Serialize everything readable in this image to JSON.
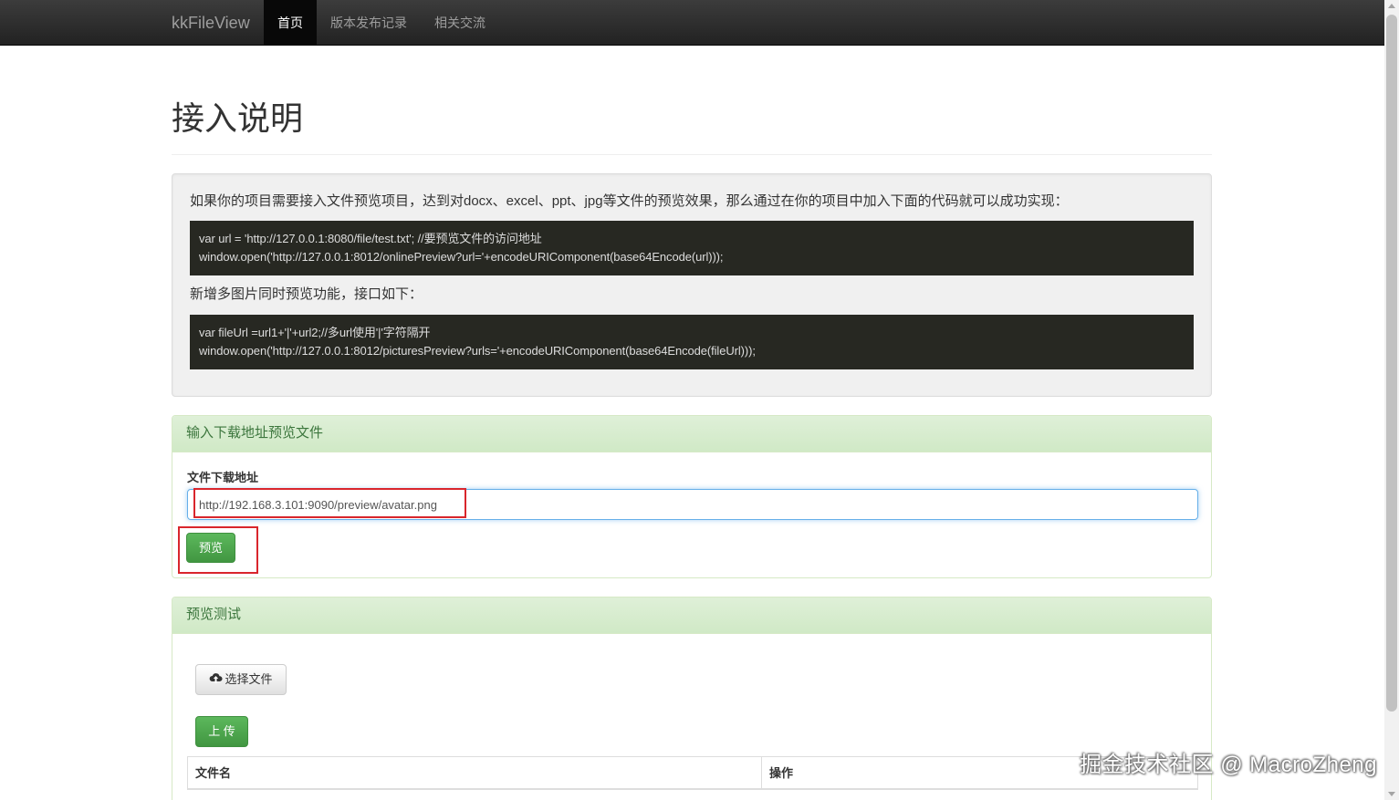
{
  "navbar": {
    "brand": "kkFileView",
    "items": [
      {
        "label": "首页",
        "active": true
      },
      {
        "label": "版本发布记录",
        "active": false
      },
      {
        "label": "相关交流",
        "active": false
      }
    ]
  },
  "page": {
    "title": "接入说明"
  },
  "well": {
    "intro": "如果你的项目需要接入文件预览项目，达到对docx、excel、ppt、jpg等文件的预览效果，那么通过在你的项目中加入下面的代码就可以成功实现：",
    "code1_line1": "var url = 'http://127.0.0.1:8080/file/test.txt'; //要预览文件的访问地址",
    "code1_line2": "window.open('http://127.0.0.1:8012/onlinePreview?url='+encodeURIComponent(base64Encode(url)));",
    "multi_intro": "新增多图片同时预览功能，接口如下：",
    "code2_line1": "var fileUrl =url1+'|'+url2;//多url使用'|'字符隔开",
    "code2_line2": "window.open('http://127.0.0.1:8012/picturesPreview?urls='+encodeURIComponent(base64Encode(fileUrl)));"
  },
  "url_panel": {
    "heading": "输入下载地址预览文件",
    "field_label": "文件下载地址",
    "field_value": "http://192.168.3.101:9090/preview/avatar.png",
    "preview_button": "预览"
  },
  "test_panel": {
    "heading": "预览测试",
    "choose_file_button": "选择文件",
    "upload_button": "上 传",
    "table_headers": [
      "文件名",
      "操作"
    ]
  },
  "watermark": "掘金技术社区 @ MacroZheng",
  "colors": {
    "navbar_bg": "#222222",
    "panel_heading_bg": "#dff0d8",
    "panel_heading_text": "#3c763d",
    "success": "#5cb85c",
    "highlight": "#d9262c",
    "code_bg": "#272822"
  }
}
